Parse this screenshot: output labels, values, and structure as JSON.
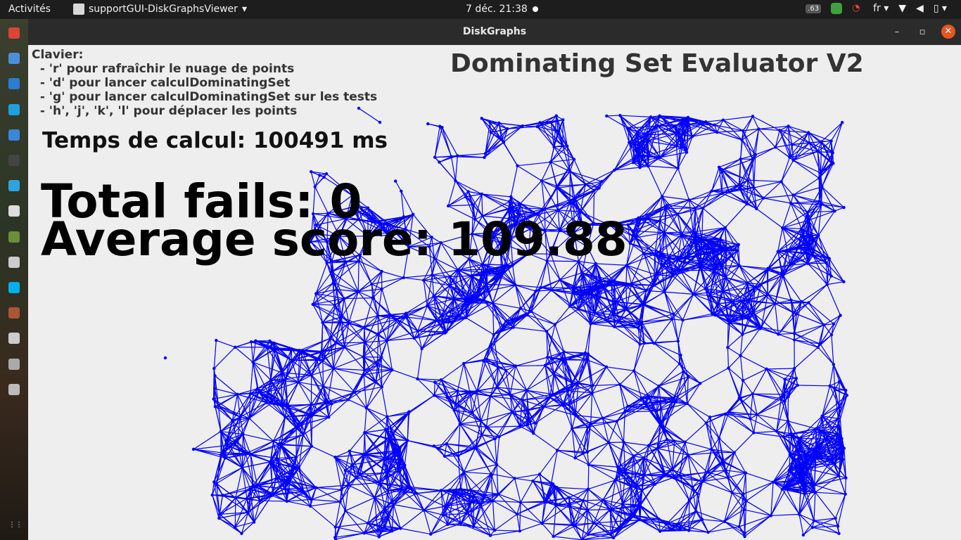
{
  "topbar": {
    "activities": "Activités",
    "app_menu": "supportGUI-DiskGraphsViewer",
    "clock": "7 déc.  21:38",
    "lang": "fr",
    "tray_badge": ".63"
  },
  "dock": {
    "icons": [
      "chrome-icon",
      "files-icon",
      "vscode-icon",
      "app-icon",
      "help-icon",
      "eclipse-icon",
      "telegram-icon",
      "window-icon",
      "minecraft-icon",
      "github-icon",
      "skype-icon",
      "gear-app-icon",
      "diskgraphs-icon",
      "trash-icon",
      "drive-icon",
      "apps-grid-icon"
    ]
  },
  "window": {
    "title": "DiskGraphs"
  },
  "app": {
    "help_text": "Clavier:\n  - 'r' pour rafraîchir le nuage de points\n  - 'd' pour lancer calculDominatingSet\n  - 'g' pour lancer calculDominatingSet sur les tests\n  - 'h', 'j', 'k', 'l' pour déplacer les points",
    "title": "Dominating Set Evaluator V2",
    "compute_time": "Temps de calcul: 100491 ms",
    "total_fails": "Total fails: 0",
    "average_score": "Average score: 109.88"
  },
  "colors": {
    "graph": "#0000ff",
    "accent": "#e95420"
  }
}
